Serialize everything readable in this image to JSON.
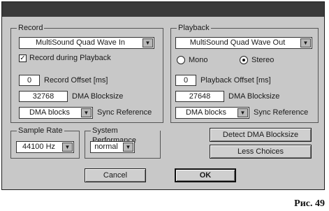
{
  "dialog": {
    "title": ""
  },
  "record": {
    "group_title": "Record",
    "device": "MultiSound Quad Wave In",
    "record_during_playback": "Record during Playback",
    "offset_value": "0",
    "offset_label": "Record Offset [ms]",
    "blocksize_value": "32768",
    "blocksize_label": "DMA Blocksize",
    "sync_value": "DMA blocks",
    "sync_label": "Sync Reference"
  },
  "playback": {
    "group_title": "Playback",
    "device": "MultiSound Quad Wave Out",
    "mono_label": "Mono",
    "stereo_label": "Stereo",
    "offset_value": "0",
    "offset_label": "Playback Offset [ms]",
    "blocksize_value": "27648",
    "blocksize_label": "DMA Blocksize",
    "sync_value": "DMA blocks",
    "sync_label": "Sync Reference"
  },
  "sample_rate": {
    "group_title": "Sample Rate",
    "value": "44100 Hz"
  },
  "system_performance": {
    "group_title": "System Performance",
    "value": "normal"
  },
  "buttons": {
    "detect": "Detect DMA Blocksize",
    "less_choices": "Less Choices",
    "cancel": "Cancel",
    "ok": "OK"
  },
  "figure_caption": "Рис. 49",
  "state": {
    "record_during_playback_checked": true,
    "stereo_selected": true
  }
}
